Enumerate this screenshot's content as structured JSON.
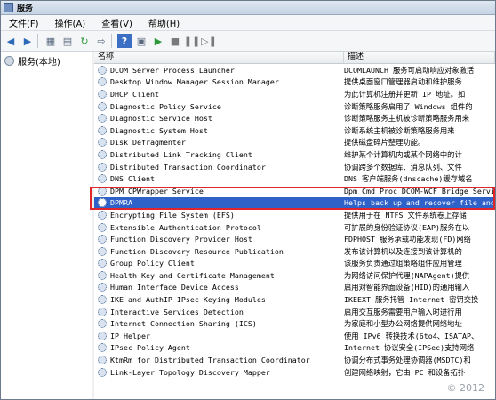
{
  "window": {
    "title": "服务"
  },
  "menu": [
    "文件(F)",
    "操作(A)",
    "查看(V)",
    "帮助(H)"
  ],
  "toolbar": {
    "icons": [
      "back-icon",
      "forward-icon",
      "show-hide-tree-icon",
      "list-view-icon",
      "refresh-icon",
      "export-icon",
      "help-icon",
      "properties-icon",
      "start-icon",
      "stop-icon",
      "pause-icon",
      "restart-icon"
    ]
  },
  "tree": {
    "root_label": "服务(本地)"
  },
  "list": {
    "columns": [
      "名称",
      "描述"
    ],
    "rows": [
      {
        "name": "DCOM Server Process Launcher",
        "desc": "DCOMLAUNCH 服务可启动响应对象激活"
      },
      {
        "name": "Desktop Window Manager Session Manager",
        "desc": "提供桌面窗口管理器启动和维护服务"
      },
      {
        "name": "DHCP Client",
        "desc": "为此计算机注册并更新 IP 地址。如"
      },
      {
        "name": "Diagnostic Policy Service",
        "desc": "诊断策略服务启用了 Windows 组件的"
      },
      {
        "name": "Diagnostic Service Host",
        "desc": "诊断策略服务主机被诊断策略服务用来"
      },
      {
        "name": "Diagnostic System Host",
        "desc": "诊断系统主机被诊断策略服务用来"
      },
      {
        "name": "Disk Defragmenter",
        "desc": "提供磁盘碎片整理功能。"
      },
      {
        "name": "Distributed Link Tracking Client",
        "desc": "维护某个计算机内或某个网络中的计"
      },
      {
        "name": "Distributed Transaction Coordinator",
        "desc": "协调跨多个数据库、消息队列、文件"
      },
      {
        "name": "DNS Client",
        "desc": "DNS 客户端服务(dnscache)缓存域名"
      },
      {
        "name": "DPM CPWrapper Service",
        "desc": "Dpm Cmd Proc DCOM-WCF Bridge Service"
      },
      {
        "name": "DPMRA",
        "desc": "Helps back up and recover file and"
      },
      {
        "name": "Encrypting File System (EFS)",
        "desc": "提供用于在 NTFS 文件系统卷上存储"
      },
      {
        "name": "Extensible Authentication Protocol",
        "desc": "可扩展的身份验证协议(EAP)服务在以"
      },
      {
        "name": "Function Discovery Provider Host",
        "desc": "FDPHOST 服务承载功能发现(FD)网络"
      },
      {
        "name": "Function Discovery Resource Publication",
        "desc": "发布该计算机以及连接到该计算机的"
      },
      {
        "name": "Group Policy Client",
        "desc": "该服务负责通过组策略组件应用管理"
      },
      {
        "name": "Health Key and Certificate Management",
        "desc": "为网络访问保护代理(NAPAgent)提供"
      },
      {
        "name": "Human Interface Device Access",
        "desc": "启用对智能界面设备(HID)的通用输入"
      },
      {
        "name": "IKE and AuthIP IPsec Keying Modules",
        "desc": "IKEEXT 服务托管 Internet 密钥交换"
      },
      {
        "name": "Interactive Services Detection",
        "desc": "启用交互服务需要用户输入时进行用"
      },
      {
        "name": "Internet Connection Sharing (ICS)",
        "desc": "为家庭和小型办公网络提供网络地址"
      },
      {
        "name": "IP Helper",
        "desc": "使用 IPv6 转换技术(6to4、ISATAP、"
      },
      {
        "name": "IPsec Policy Agent",
        "desc": "Internet 协议安全(IPSec)支持网络"
      },
      {
        "name": "KtmRm for Distributed Transaction Coordinator",
        "desc": "协调分布式事务处理协调器(MSDTC)和"
      },
      {
        "name": "Link-Layer Topology Discovery Mapper",
        "desc": "创建网络映射，它由 PC 和设备拓扑"
      }
    ],
    "selected_row": "DPMRA"
  },
  "watermark": "© 2012",
  "colors": {
    "selection": "#2f62c8",
    "highlight_box": "#e0262b"
  }
}
